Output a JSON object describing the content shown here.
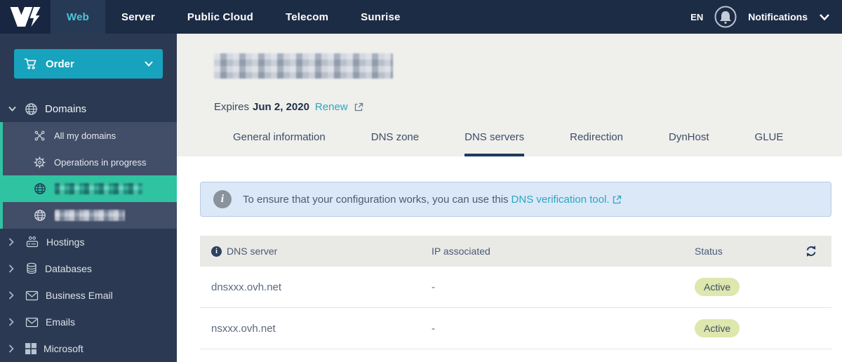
{
  "topbar": {
    "brand": "OVH",
    "nav": [
      {
        "label": "Web",
        "active": true
      },
      {
        "label": "Server",
        "active": false
      },
      {
        "label": "Public Cloud",
        "active": false
      },
      {
        "label": "Telecom",
        "active": false
      },
      {
        "label": "Sunrise",
        "active": false
      }
    ],
    "language": "EN",
    "notifications_label": "Notifications"
  },
  "sidebar": {
    "order_label": "Order",
    "domains": {
      "label": "Domains",
      "children": [
        "All my domains",
        "Operations in progress"
      ],
      "selected_domain_redacted": true,
      "second_domain_redacted": true
    },
    "items": [
      {
        "label": "Hostings"
      },
      {
        "label": "Databases"
      },
      {
        "label": "Business Email"
      },
      {
        "label": "Emails"
      },
      {
        "label": "Microsoft"
      }
    ]
  },
  "header": {
    "title_redacted": true,
    "expires_label": "Expires",
    "expires_date": "Jun 2, 2020",
    "renew_label": "Renew",
    "tabs": [
      {
        "label": "General information",
        "active": false
      },
      {
        "label": "DNS zone",
        "active": false
      },
      {
        "label": "DNS servers",
        "active": true
      },
      {
        "label": "Redirection",
        "active": false
      },
      {
        "label": "DynHost",
        "active": false
      },
      {
        "label": "GLUE",
        "active": false
      }
    ]
  },
  "banner": {
    "text": "To ensure that your configuration works, you can use this",
    "link_label": "DNS verification tool."
  },
  "table": {
    "columns": [
      "DNS server",
      "IP associated",
      "Status"
    ],
    "rows": [
      {
        "server": "dnsxxx.ovh.net",
        "ip": "-",
        "status": "Active"
      },
      {
        "server": "nsxxx.ovh.net",
        "ip": "-",
        "status": "Active"
      }
    ]
  },
  "colors": {
    "topbar_bg": "#1d2c45",
    "topbar_active_text": "#4cc6da",
    "sidebar_bg": "#2b3a52",
    "submenu_bg": "#424e68",
    "selected_teal": "#2fc3a2",
    "order_button": "#17a3bd",
    "link_cyan": "#2ba6c0",
    "tab_underline": "#1d3a5f",
    "banner_bg": "#dbe8f8",
    "banner_border": "#b7cbe5",
    "table_header_bg": "#e9e9e6",
    "badge_bg": "#dde7ae",
    "badge_text": "#3d4c64"
  }
}
